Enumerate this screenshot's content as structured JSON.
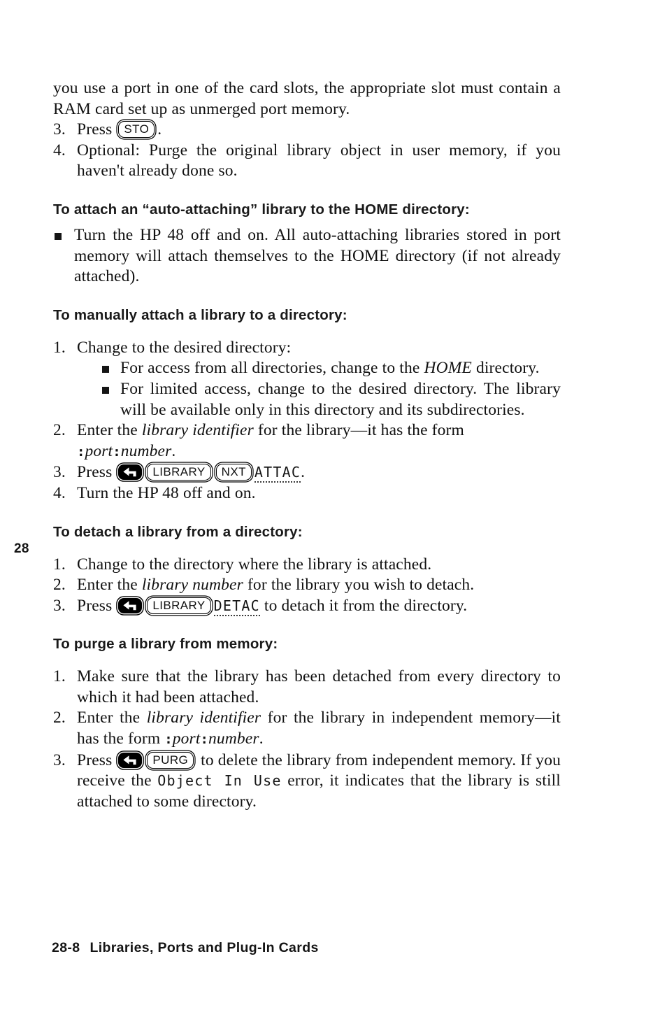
{
  "page": {
    "chapter_marker": "28",
    "footer_number": "28-8",
    "footer_title": "Libraries, Ports and Plug-In Cards"
  },
  "intro": {
    "line1_pre": "you use a port in one of the card slots, the appropriate slot must contain a RAM card set up as unmerged port memory.",
    "steps": [
      {
        "num": "3.",
        "pre": "Press ",
        "key": "STO",
        "post": "."
      },
      {
        "num": "4.",
        "text": "Optional: Purge the original library object in user memory, if you haven't already done so."
      }
    ]
  },
  "sections": [
    {
      "heading": "To attach an “auto-attaching” library to the HOME directory:",
      "bullets": [
        "Turn the HP 48 off and on. All auto-attaching libraries stored in port memory will attach themselves to the HOME directory (if not already attached)."
      ]
    },
    {
      "heading": "To manually attach a library to a directory:",
      "steps": [
        {
          "num": "1.",
          "text": "Change to the desired directory:",
          "subbullets": [
            {
              "pre": "For access from all directories, change to the ",
              "ital": "HOME",
              "post": " directory."
            },
            {
              "pre": "For limited access, change to the desired directory. The library will be available only in this directory and its subdirectories.",
              "ital": "",
              "post": ""
            }
          ]
        },
        {
          "num": "2.",
          "pre": "Enter the ",
          "ital": "library identifier",
          "mid": " for the library—it has the form",
          "form_colon": ":",
          "form_port": "port",
          "form_number": "number",
          "post": "."
        },
        {
          "num": "3.",
          "pre": "Press ",
          "shift": "left-shift",
          "key1": "LIBRARY",
          "key2": "NXT",
          "menu": "ATTAC",
          "post": "."
        },
        {
          "num": "4.",
          "text": "Turn the HP 48 off and on."
        }
      ]
    },
    {
      "heading": "To detach a library from a directory:",
      "steps": [
        {
          "num": "1.",
          "text": "Change to the directory where the library is attached."
        },
        {
          "num": "2.",
          "pre": "Enter the ",
          "ital": "library number",
          "post": " for the library you wish to detach."
        },
        {
          "num": "3.",
          "pre": "Press ",
          "shift": "left-shift",
          "key1": "LIBRARY",
          "menu": "DETAC",
          "post": " to detach it from the directory."
        }
      ]
    },
    {
      "heading": "To purge a library from memory:",
      "steps": [
        {
          "num": "1.",
          "text": "Make sure that the library has been detached from every directory to which it had been attached."
        },
        {
          "num": "2.",
          "pre": "Enter the ",
          "ital": "library identifier",
          "mid": " for the library in independent memory—it has the form ",
          "form_colon": ":",
          "form_port": "port",
          "form_number": "number",
          "post": "."
        },
        {
          "num": "3.",
          "pre": "Press ",
          "shift": "left-shift",
          "key1": "PURG",
          "mid": " to delete the library from independent memory. If you receive the ",
          "display": "Object In Use",
          "post": " error, it indicates that the library is still attached to some directory."
        }
      ]
    }
  ]
}
